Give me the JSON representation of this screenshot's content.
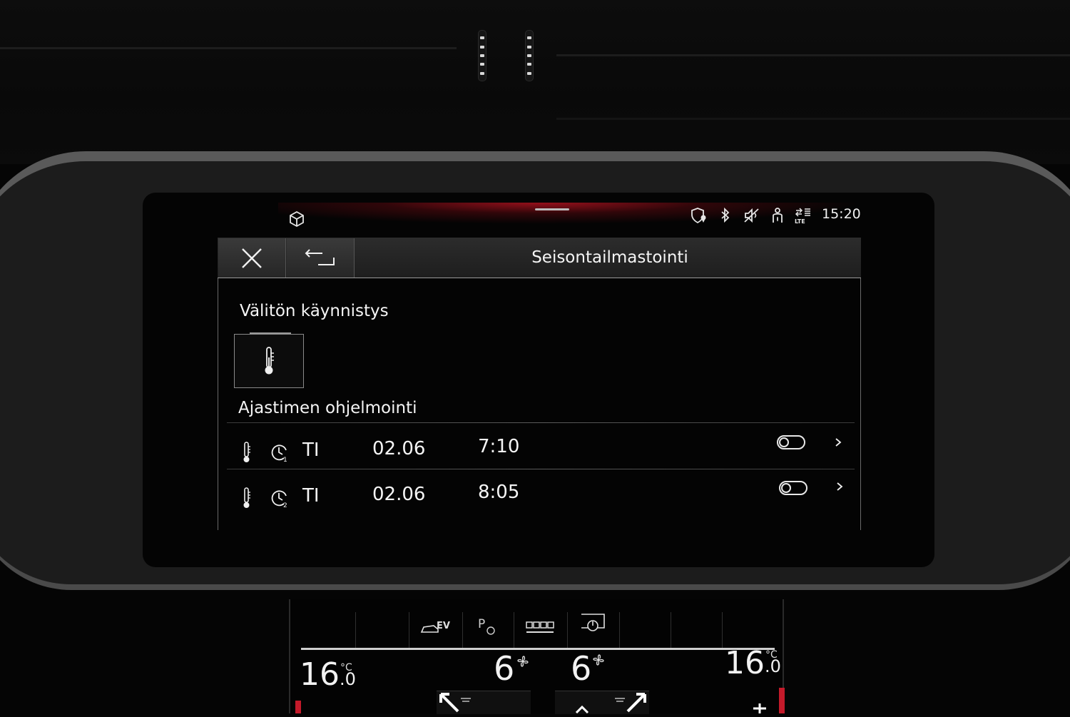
{
  "status_bar": {
    "time": "15:20",
    "icons": [
      "cube-icon",
      "shield-location-icon",
      "bluetooth-icon",
      "speaker-muted-icon",
      "person-seat-icon",
      "lte-icon"
    ]
  },
  "window": {
    "title": "Seisontailmastointi",
    "close_icon": "close-icon",
    "back_icon": "back-arrow-icon"
  },
  "instant_start": {
    "heading": "Välitön käynnistys",
    "icon": "thermometer-icon"
  },
  "timer_programming": {
    "heading": "Ajastimen ohjelmointi",
    "rows": [
      {
        "timer_index": "1",
        "day": "TI",
        "date": "02.06",
        "time": "7:10",
        "enabled": false
      },
      {
        "timer_index": "2",
        "day": "TI",
        "date": "02.06",
        "time": "8:05",
        "enabled": false
      }
    ]
  },
  "climate_panel": {
    "tabs": [
      "",
      "",
      "EV",
      "P",
      "",
      "",
      "",
      "",
      ""
    ],
    "left_temp": "16",
    "left_temp_decimal": ".0",
    "right_temp": "16",
    "right_temp_decimal": ".0",
    "temp_unit": "°C",
    "left_fan": "6",
    "right_fan": "6"
  }
}
